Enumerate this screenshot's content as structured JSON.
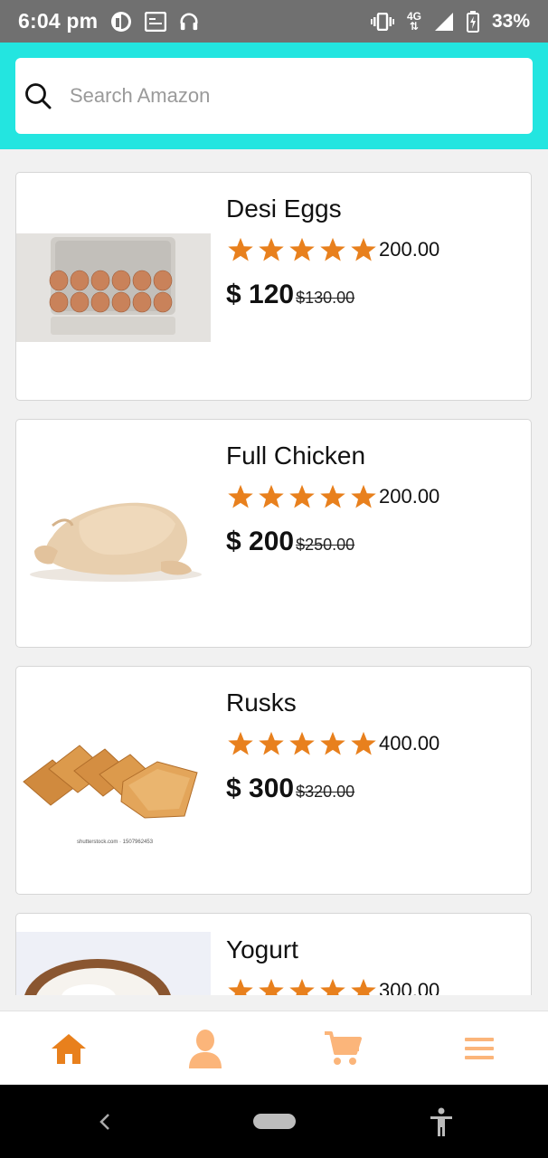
{
  "status_bar": {
    "time": "6:04 pm",
    "network": "4G",
    "battery": "33%"
  },
  "search": {
    "placeholder": "Search Amazon",
    "icon": "search-icon"
  },
  "products": [
    {
      "name": "Desi Eggs",
      "rating": 5,
      "rating_count": "200.00",
      "price": "$ 120",
      "old_price": "$130.00"
    },
    {
      "name": "Full Chicken",
      "rating": 5,
      "rating_count": "200.00",
      "price": "$ 200",
      "old_price": "$250.00"
    },
    {
      "name": "Rusks",
      "rating": 5,
      "rating_count": "400.00",
      "price": "$ 300",
      "old_price": "$320.00"
    },
    {
      "name": "Yogurt",
      "rating": 5,
      "rating_count": "300.00",
      "price": "",
      "old_price": ""
    }
  ],
  "image_captions": {
    "rusks_watermark": "shutterstock.com · 1507962453"
  },
  "bottom_nav": [
    {
      "icon": "home-icon",
      "active": true
    },
    {
      "icon": "profile-icon",
      "active": false
    },
    {
      "icon": "cart-icon",
      "active": false
    },
    {
      "icon": "menu-icon",
      "active": false
    }
  ],
  "colors": {
    "header_bg": "#23e5e0",
    "star": "#e8801d",
    "nav_active": "#e8801d",
    "nav_inactive": "#fbb57a",
    "status_bar": "#707070"
  }
}
